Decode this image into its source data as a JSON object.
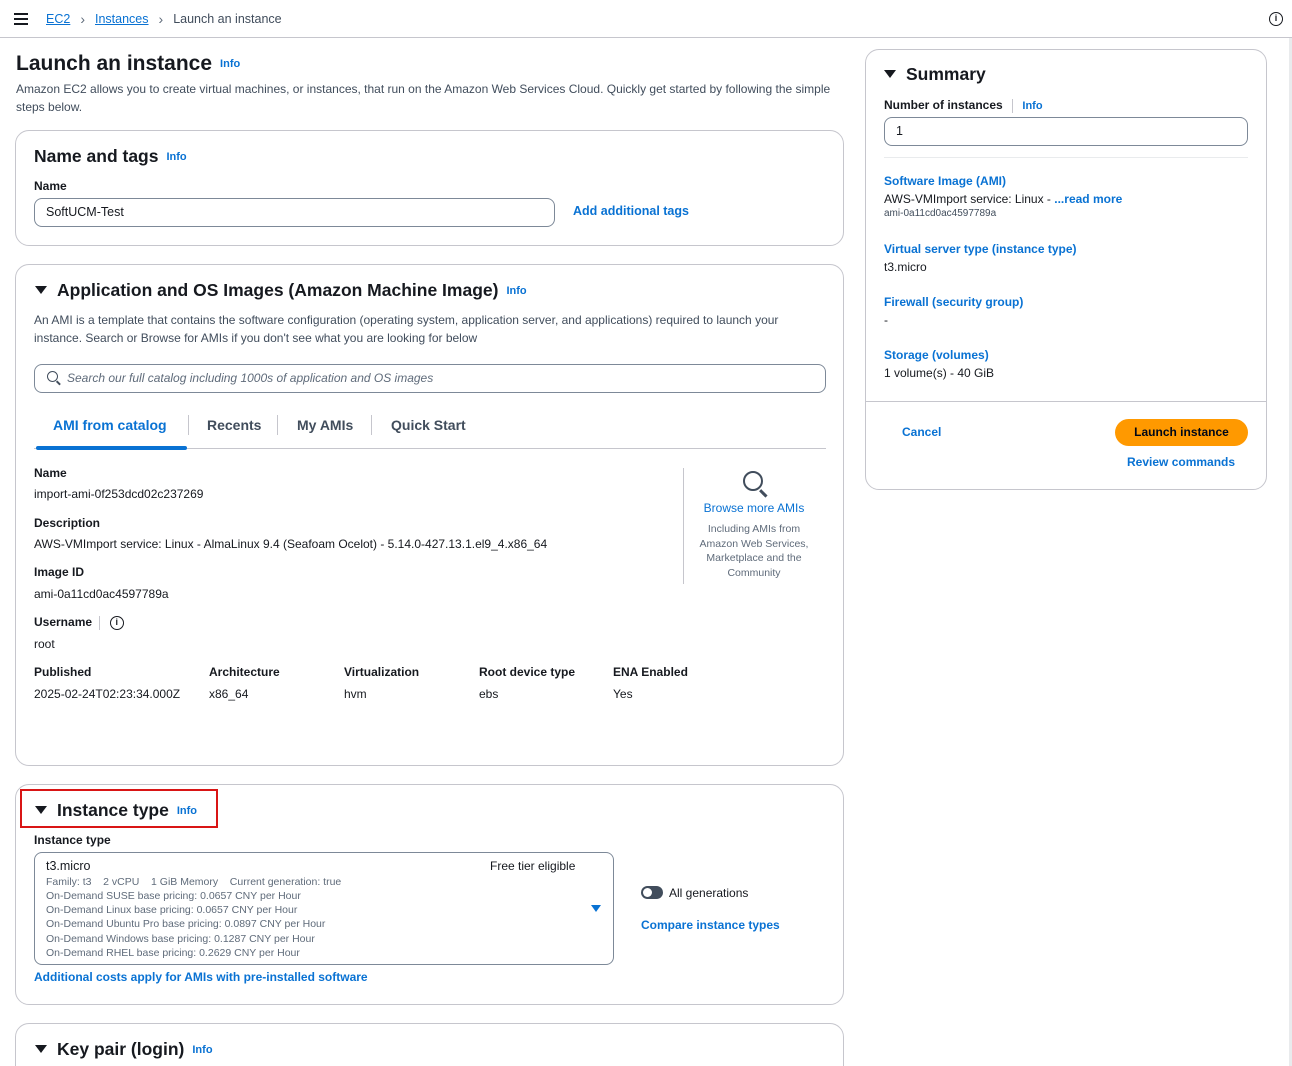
{
  "breadcrumb": {
    "items": [
      "EC2",
      "Instances"
    ],
    "current": "Launch an instance"
  },
  "page": {
    "title": "Launch an instance",
    "info": "Info",
    "description": "Amazon EC2 allows you to create virtual machines, or instances, that run on the Amazon Web Services Cloud. Quickly get started by following the simple steps below."
  },
  "name_tags": {
    "title": "Name and tags",
    "info": "Info",
    "name_label": "Name",
    "name_value": "SoftUCM-Test",
    "add_tags": "Add additional tags"
  },
  "ami": {
    "title": "Application and OS Images (Amazon Machine Image)",
    "info": "Info",
    "description": "An AMI is a template that contains the software configuration (operating system, application server, and applications) required to launch your instance. Search or Browse for AMIs if you don't see what you are looking for below",
    "search_placeholder": "Search our full catalog including 1000s of application and OS images",
    "tabs": [
      "AMI from catalog",
      "Recents",
      "My AMIs",
      "Quick Start"
    ],
    "name_label": "Name",
    "name_value": "import-ami-0f253dcd02c237269",
    "desc_label": "Description",
    "desc_value": "AWS-VMImport service: Linux - AlmaLinux 9.4 (Seafoam Ocelot) - 5.14.0-427.13.1.el9_4.x86_64",
    "image_id_label": "Image ID",
    "image_id_value": "ami-0a11cd0ac4597789a",
    "username_label": "Username",
    "username_value": "root",
    "details": [
      {
        "label": "Published",
        "value": "2025-02-24T02:23:34.000Z"
      },
      {
        "label": "Architecture",
        "value": "x86_64"
      },
      {
        "label": "Virtualization",
        "value": "hvm"
      },
      {
        "label": "Root device type",
        "value": "ebs"
      },
      {
        "label": "ENA Enabled",
        "value": "Yes"
      }
    ],
    "browse_title": "Browse more AMIs",
    "browse_desc": [
      "Including AMIs from",
      "Amazon Web Services,",
      "Marketplace and the",
      "Community"
    ]
  },
  "instance_type": {
    "title": "Instance type",
    "info": "Info",
    "label": "Instance type",
    "selected": "t3.micro",
    "badge": "Free tier eligible",
    "details": [
      "Family: t3    2 vCPU    1 GiB Memory    Current generation: true",
      "On-Demand SUSE base pricing: 0.0657 CNY per Hour",
      "On-Demand Linux base pricing: 0.0657 CNY per Hour",
      "On-Demand Ubuntu Pro base pricing: 0.0897 CNY per Hour",
      "On-Demand Windows base pricing: 0.1287 CNY per Hour",
      "On-Demand RHEL base pricing: 0.2629 CNY per Hour"
    ],
    "all_generations": "All generations",
    "compare": "Compare instance types",
    "additional_costs": "Additional costs apply for AMIs with pre-installed software"
  },
  "key_pair": {
    "title": "Key pair (login)",
    "info": "Info"
  },
  "summary": {
    "title": "Summary",
    "num_label": "Number of instances",
    "info": "Info",
    "num_value": "1",
    "ami_label": "Software Image (AMI)",
    "ami_value": "AWS-VMImport service: Linux - ",
    "ami_read_more": "...read more",
    "ami_id": "ami-0a11cd0ac4597789a",
    "type_label": "Virtual server type (instance type)",
    "type_value": "t3.micro",
    "fw_label": "Firewall (security group)",
    "fw_value": "-",
    "storage_label": "Storage (volumes)",
    "storage_value": "1 volume(s) - 40 GiB",
    "cancel": "Cancel",
    "launch": "Launch instance",
    "review": "Review commands"
  },
  "colors": {
    "link": "#0972d3",
    "primary_button": "#ff9900",
    "highlight": "#d91515"
  }
}
